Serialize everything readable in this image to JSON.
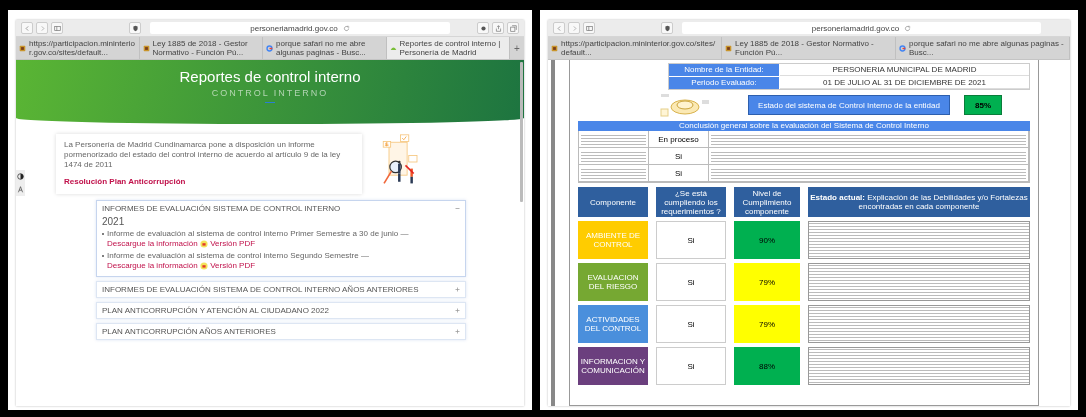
{
  "left_window": {
    "address": "personeriamadrid.gov.co",
    "extra_toolbar_icons": true,
    "new_tab_button": "+",
    "tabs": [
      {
        "label": "https://participacion.mininterior.gov.co/sites/default...",
        "selected": false
      },
      {
        "label": "Ley 1885 de 2018 - Gestor Normativo - Función Pú...",
        "selected": false
      },
      {
        "label": "porque safari no me abre algunas paginas - Busc...",
        "selected": false
      },
      {
        "label": "Reportes de control interno | Personería de Madrid",
        "selected": true
      }
    ],
    "page": {
      "kind": "website",
      "header": {
        "title": "Reportes de control interno",
        "backdrop": "CONTROL INTERNO"
      },
      "intro": {
        "text": "La Personería de Madrid Cundinamarca pone a disposición un informe pormenorizado del estado del control interno de acuerdo al artículo 9 de la ley 1474 de 2011",
        "link": "Resolución Plan Anticorrupción"
      },
      "accordion": [
        {
          "title": "INFORMES DE EVALUACIÓN SISTEMA DE CONTROL INTERNO",
          "expanded": true,
          "year": "2021",
          "items": [
            {
              "text": "Informe de evaluación al sistema de control interno Primer Semestre a 30 de junio —",
              "link": "Descargue la información",
              "pdf_link": "Versión PDF"
            },
            {
              "text": "Informe de evaluación al sistema de control interno Segundo Semestre —",
              "link": "Descargue la información",
              "pdf_link": "Versión PDF"
            }
          ]
        },
        {
          "title": "INFORMES DE EVALUACIÓN SISTEMA DE CONTROL INTERNO AÑOS ANTERIORES",
          "expanded": false
        },
        {
          "title": "PLAN ANTICORRUPCIÓN Y ATENCIÓN AL CIUDADANO 2022",
          "expanded": false
        },
        {
          "title": "PLAN ANTICORRUPCIÓN AÑOS ANTERIORES",
          "expanded": false
        }
      ]
    }
  },
  "right_window": {
    "address": "personeriamadrid.gov.co",
    "extra_toolbar_icons": false,
    "tabs": [
      {
        "label": "https://participacion.mininterior.gov.co/sites/default...",
        "selected": false
      },
      {
        "label": "Ley 1885 de 2018 - Gestor Normativo - Función Pú...",
        "selected": false
      },
      {
        "label": "porque safari no me abre algunas paginas - Busc...",
        "selected": false
      }
    ],
    "page": {
      "kind": "document",
      "entity": [
        {
          "label": "Nombre de la Entidad:",
          "value": "PERSONERIA MUNICIPAL DE MADRID"
        },
        {
          "label": "Periodo Evaluado:",
          "value": "01 DE JULIO AL 31 DE DICIEMBRE DE 2021"
        }
      ],
      "status": {
        "label": "Estado del sistema de Control Interno de la entidad",
        "value": "85%"
      },
      "conclusion_title": "Conclusión general sobre la evaluación del Sistema de Control Interno",
      "conclusions": [
        {
          "answer": "En proceso"
        },
        {
          "answer": "Si"
        },
        {
          "answer": "Si"
        }
      ],
      "component_headers": [
        "Componente",
        "¿Se está cumpliendo los requerimientos ?",
        "Nivel de Cumplimiento componente",
        "**Estado actual:** Explicación de las Debilidades y/o Fortalezas encontradas en cada componente"
      ],
      "components": [
        {
          "name": "AMBIENTE DE CONTROL",
          "color": "#ffcc00",
          "answer": "Si",
          "compliance": {
            "text": "90%",
            "color": "#00b050"
          }
        },
        {
          "name": "EVALUACION DEL RIESGO",
          "color": "#76a832",
          "answer": "Si",
          "compliance": {
            "text": "79%",
            "color": "#ffff00"
          }
        },
        {
          "name": "ACTIVIDADES DEL CONTROL",
          "color": "#4a8fdc",
          "answer": "Si",
          "compliance": {
            "text": "79%",
            "color": "#ffff00"
          }
        },
        {
          "name": "INFORMACION Y COMUNICACIÓN",
          "color": "#6b3f7e",
          "answer": "Si",
          "compliance": {
            "text": "88%",
            "color": "#00b050"
          }
        }
      ]
    }
  }
}
